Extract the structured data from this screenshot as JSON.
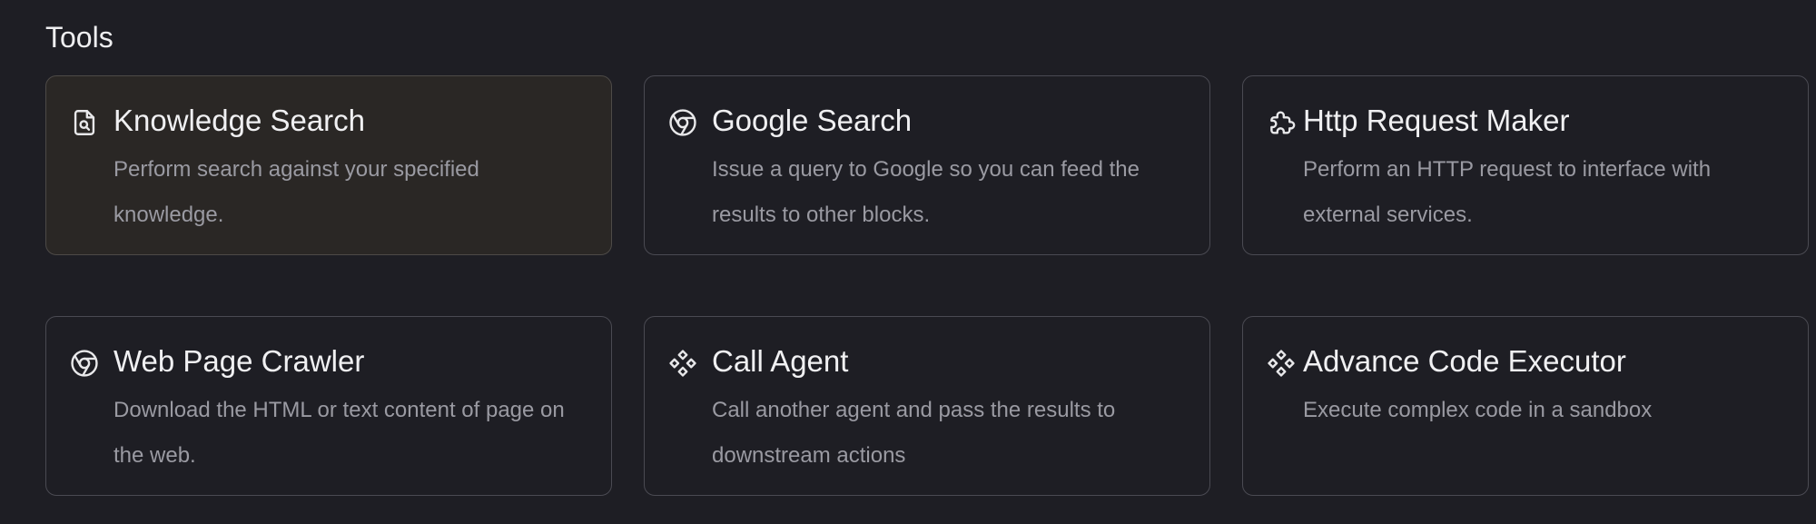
{
  "section": {
    "title": "Tools"
  },
  "tools": [
    {
      "name": "Knowledge Search",
      "description": "Perform search against your specified knowledge.",
      "icon": "document-search-icon",
      "selected": true
    },
    {
      "name": "Google Search",
      "description": "Issue a query to Google so you can feed the results to other blocks.",
      "icon": "chrome-icon",
      "selected": false
    },
    {
      "name": "Http Request Maker",
      "description": "Perform an HTTP request to interface with external services.",
      "icon": "api-icon",
      "selected": false
    },
    {
      "name": "Web Page Crawler",
      "description": "Download the HTML or text content of page on the web.",
      "icon": "chrome-icon",
      "selected": false
    },
    {
      "name": "Call Agent",
      "description": "Call another agent and pass the results to downstream actions",
      "icon": "diamond-cluster-icon",
      "selected": false
    },
    {
      "name": "Advance Code Executor",
      "description": "Execute complex code in a sandbox",
      "icon": "diamond-cluster-icon",
      "selected": false
    }
  ],
  "colors": {
    "background": "#1e1e24",
    "card_border": "#4a4a52",
    "selected_card_background": "#2a2725",
    "title_text": "#f0f0f2",
    "description_text": "#9a9aa2"
  }
}
